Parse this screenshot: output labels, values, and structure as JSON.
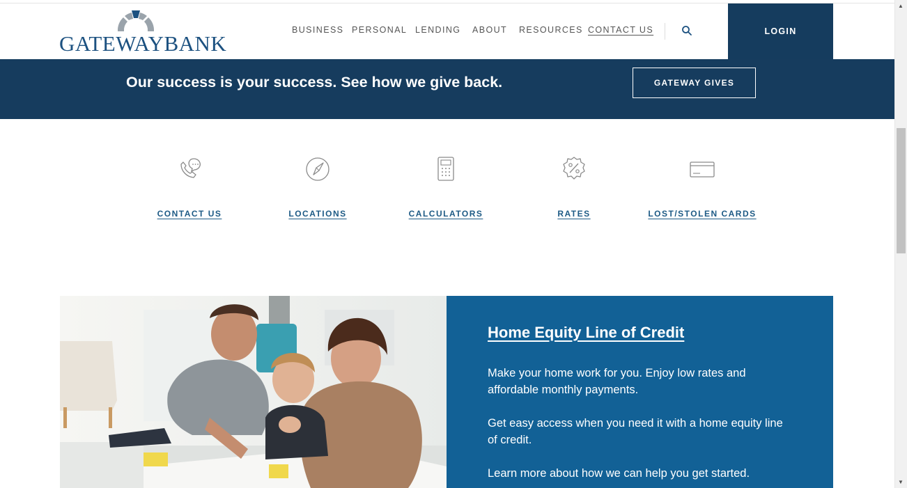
{
  "brand": {
    "name": "GATEWAYBANK",
    "colors": {
      "primary": "#163c5e",
      "accent": "#126196",
      "link": "#1d5a85"
    }
  },
  "nav": {
    "items": [
      {
        "label": "BUSINESS"
      },
      {
        "label": "PERSONAL"
      },
      {
        "label": "LENDING"
      },
      {
        "label": "ABOUT"
      },
      {
        "label": "RESOURCES"
      },
      {
        "label": "CONTACT US"
      }
    ],
    "search_icon": "search-icon",
    "login_label": "LOGIN"
  },
  "banner": {
    "text": "Our success is your success.  See how we give back.",
    "button_label": "GATEWAY GIVES"
  },
  "quick_links": [
    {
      "label": "CONTACT US",
      "icon": "phone-chat-icon"
    },
    {
      "label": "LOCATIONS",
      "icon": "compass-icon"
    },
    {
      "label": "CALCULATORS",
      "icon": "calculator-icon"
    },
    {
      "label": "RATES",
      "icon": "percent-badge-icon"
    },
    {
      "label": "LOST/STOLEN CARDS",
      "icon": "credit-card-icon"
    }
  ],
  "feature": {
    "title": "Home Equity Line of Credit",
    "paragraphs": [
      "Make your home work for you. Enjoy low rates and affordable monthly payments.",
      "Get easy access when you need it with a home equity line of credit.",
      "Learn more about how we can help you get started."
    ]
  }
}
